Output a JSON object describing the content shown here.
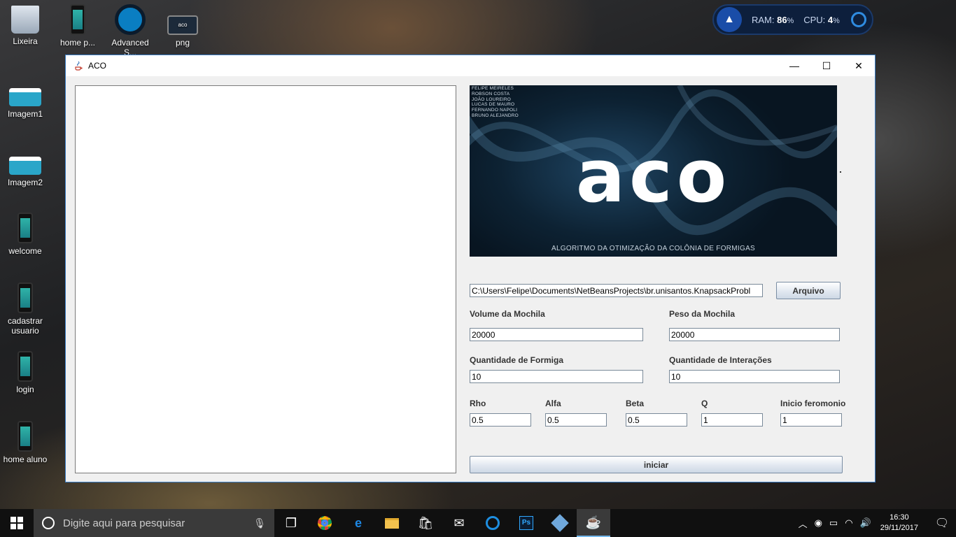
{
  "desktop": {
    "icons": [
      {
        "label": "Lixeira"
      },
      {
        "label": "home p..."
      },
      {
        "label": "Advanced S..."
      },
      {
        "label": "png"
      },
      {
        "label": "Imagem1"
      },
      {
        "label": "Imagem2"
      },
      {
        "label": "welcome"
      },
      {
        "label": "cadastrar usuario"
      },
      {
        "label": "login"
      },
      {
        "label": "home aluno"
      }
    ],
    "png_thumb_text": "aco"
  },
  "monitor": {
    "ram_label": "RAM:",
    "ram_value": "86",
    "cpu_label": "CPU:",
    "cpu_value": "4",
    "percent": "%"
  },
  "window": {
    "title": "ACO",
    "controls": {
      "minimize": "—",
      "maximize": "☐",
      "close": "✕"
    },
    "banner": {
      "credits": [
        "FELIPE MEIRELES",
        "ROBSON COSTA",
        "JOÃO LOUREIRO",
        "LUCAS DE MAURO",
        "FERNANDO NAPOLI",
        "BRUNO ALEJANDRO"
      ],
      "logo": "aco",
      "subtitle": "ALGORITMO DA OTIMIZAÇÃO DA COLÔNIA DE FORMIGAS"
    },
    "file_path": "C:\\Users\\Felipe\\Documents\\NetBeansProjects\\br.unisantos.KnapsackProbl",
    "arquivo_button": "Arquivo",
    "volume_label": "Volume da Mochila",
    "volume_value": "20000",
    "peso_label": "Peso da Mochila",
    "peso_value": "20000",
    "formiga_label": "Quantidade de Formiga",
    "formiga_value": "10",
    "interacoes_label": "Quantidade de Interações",
    "interacoes_value": "10",
    "rho_label": "Rho",
    "rho_value": "0.5",
    "alfa_label": "Alfa",
    "alfa_value": "0.5",
    "beta_label": "Beta",
    "beta_value": "0.5",
    "q_label": "Q",
    "q_value": "1",
    "feromonio_label": "Inicio feromonio",
    "feromonio_value": "1",
    "iniciar_button": "iniciar"
  },
  "taskbar": {
    "search_placeholder": "Digite aqui para pesquisar",
    "time": "16:30",
    "date": "29/11/2017",
    "pinned": [
      "task-view",
      "chrome",
      "edge",
      "file-explorer",
      "store",
      "mail",
      "advanced-systemcare",
      "photoshop",
      "virtualbox",
      "java"
    ]
  }
}
